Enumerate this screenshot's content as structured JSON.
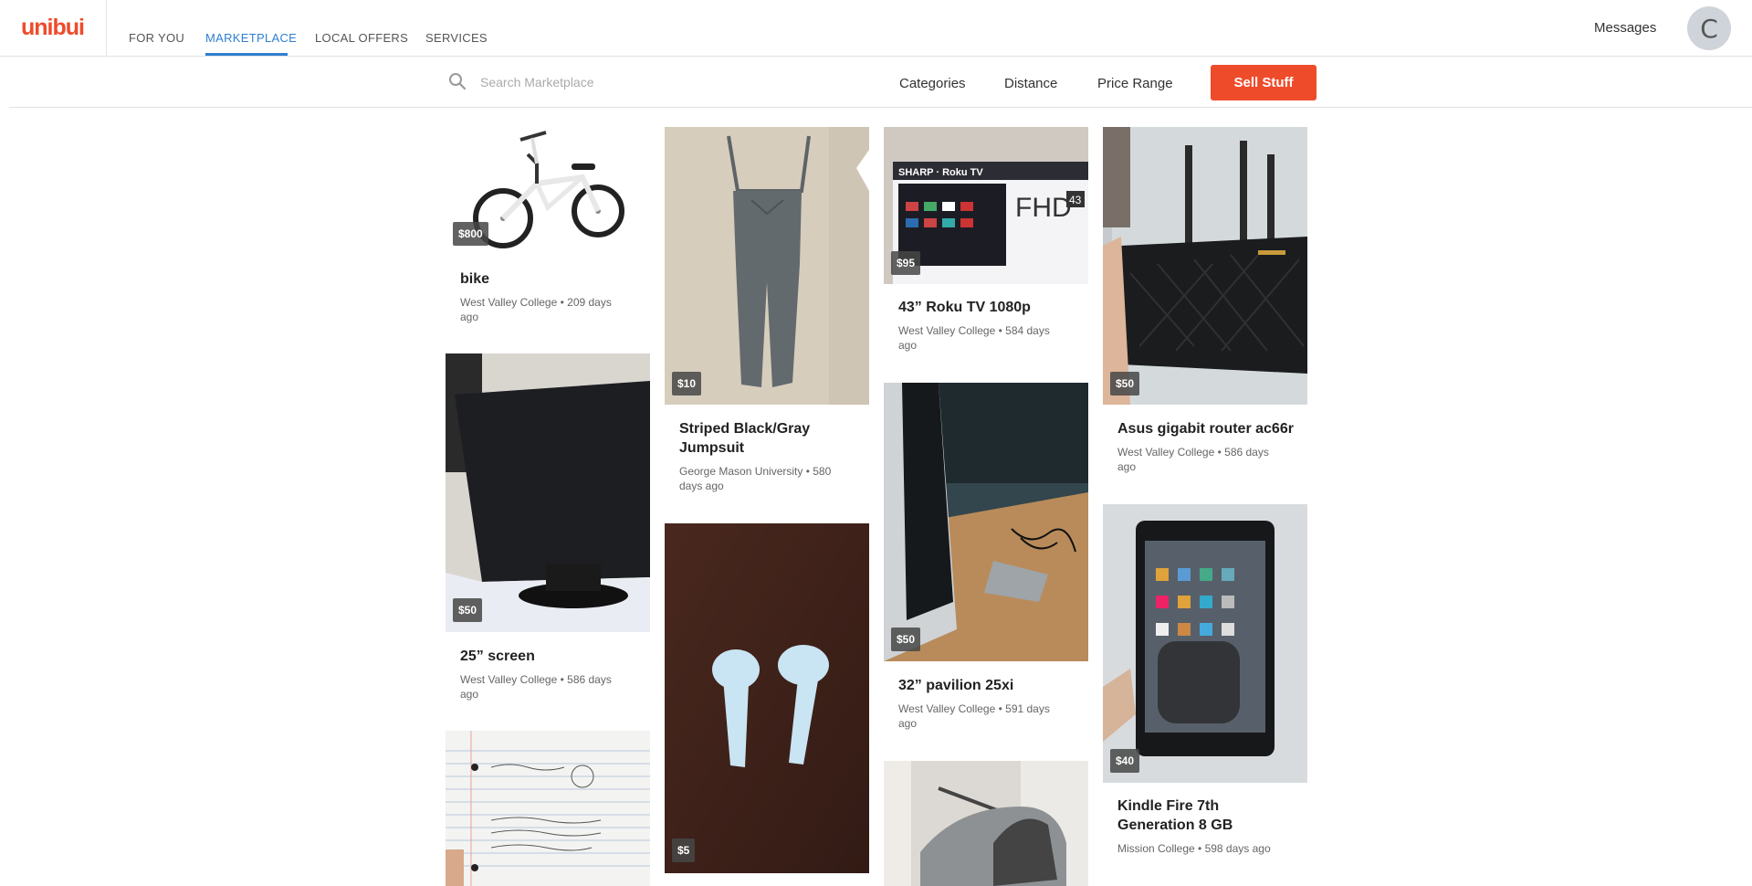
{
  "brand": {
    "logo": "unibui",
    "color": "#ee4b2b"
  },
  "nav": {
    "tabs": [
      {
        "label": "FOR YOU",
        "active": false
      },
      {
        "label": "MARKETPLACE",
        "active": true
      },
      {
        "label": "LOCAL OFFERS",
        "active": false
      },
      {
        "label": "SERVICES",
        "active": false
      }
    ],
    "messages": "Messages",
    "avatar_initial": "C",
    "accent": "#2f7fd1"
  },
  "search": {
    "placeholder": "Search Marketplace",
    "value": "",
    "icon": "search-icon"
  },
  "filters": [
    "Categories",
    "Distance",
    "Price Range"
  ],
  "sell_button": "Sell Stuff",
  "listings": [
    {
      "title": "bike",
      "price": "$800",
      "meta": "West Valley College • 209 days ago",
      "image": "bike photo"
    },
    {
      "title": "25” screen",
      "price": "$50",
      "meta": "West Valley College • 586 days ago",
      "image": "monitor photo"
    },
    {
      "title": "",
      "price": "",
      "meta": "",
      "image": "notebook page photo"
    },
    {
      "title": "Striped Black/Gray Jumpsuit",
      "price": "$10",
      "meta": "George Mason University • 580 days ago",
      "image": "jumpsuit photo"
    },
    {
      "title": "",
      "price": "$5",
      "meta": "",
      "image": "earbuds photo"
    },
    {
      "title": "43” Roku TV 1080p",
      "price": "$95",
      "meta": "West Valley College • 584 days ago",
      "image": "tv box photo"
    },
    {
      "title": "32” pavilion 25xi",
      "price": "$50",
      "meta": "West Valley College • 591 days ago",
      "image": "monitor photo"
    },
    {
      "title": "",
      "price": "",
      "meta": "",
      "image": "shoes photo"
    },
    {
      "title": "Asus gigabit router ac66r",
      "price": "$50",
      "meta": "West Valley College • 586 days ago",
      "image": "router photo"
    },
    {
      "title": "Kindle Fire 7th Generation 8 GB",
      "price": "$40",
      "meta": "Mission College • 598 days ago",
      "image": "tablet photo"
    }
  ]
}
